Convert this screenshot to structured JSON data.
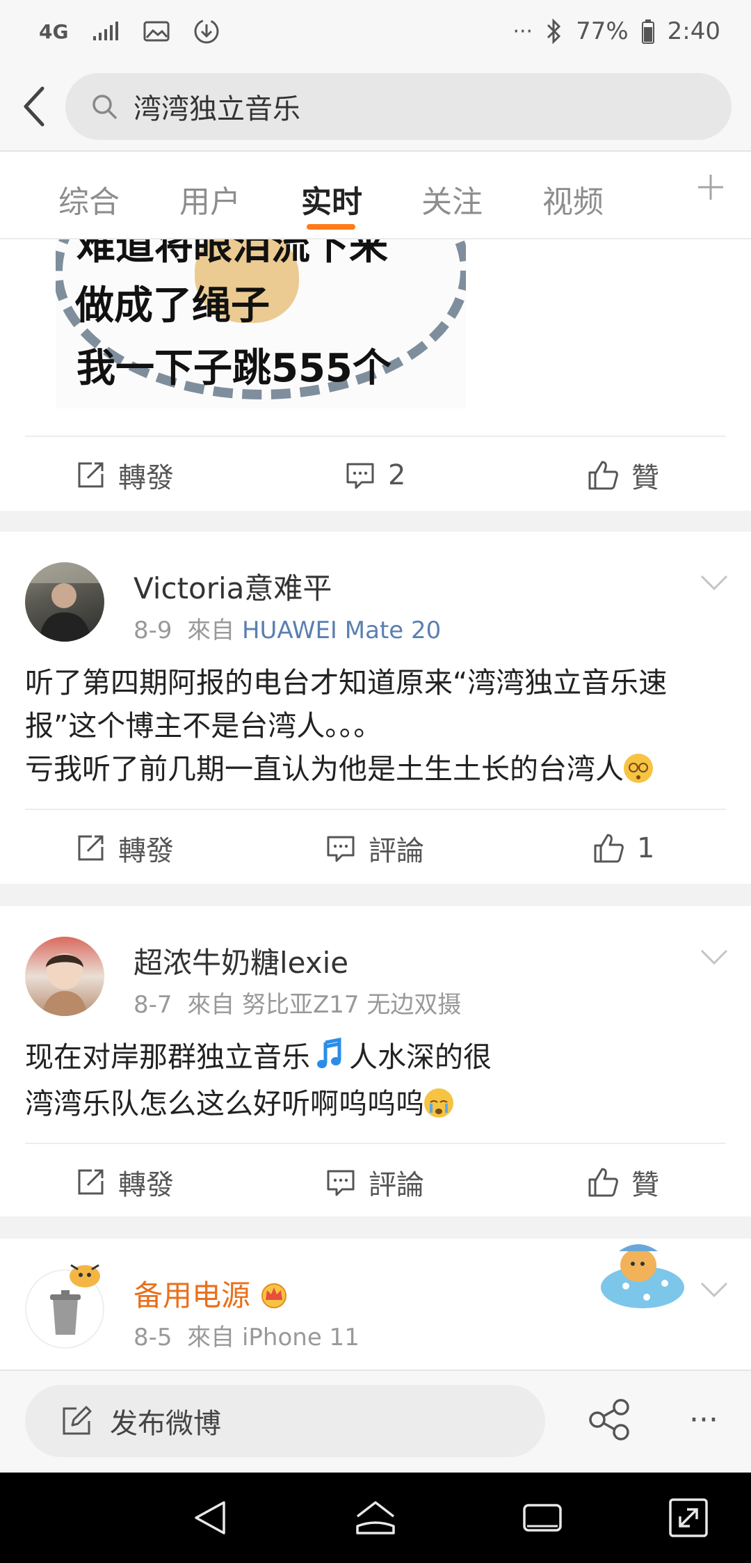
{
  "status_bar": {
    "network": "4G",
    "more": "···",
    "battery": "77%",
    "time": "2:40"
  },
  "search": {
    "query": "湾湾独立音乐"
  },
  "tabs": [
    {
      "label": "综合"
    },
    {
      "label": "用户"
    },
    {
      "label": "实时"
    },
    {
      "label": "关注"
    },
    {
      "label": "视频"
    }
  ],
  "top_card": {
    "meme_lines": [
      "难道将眼泪流下来",
      "做成了绳子",
      "我一下子跳555个"
    ],
    "actions": {
      "repost": "轉發",
      "comment": "2",
      "like": "贊"
    }
  },
  "posts": [
    {
      "username": "Victoria意难平",
      "date": "8-9",
      "from": "來自",
      "source": "HUAWEI Mate 20",
      "lines": [
        "听了第四期阿报的电台才知道原来“湾湾独立音乐速",
        "报”这个博主不是台湾人。。。",
        "亏我听了前几期一直认为他是土生土长的台湾人"
      ],
      "actions": {
        "repost": "轉發",
        "comment": "評論",
        "like": "1"
      }
    },
    {
      "username": "超浓牛奶糖lexie",
      "date": "8-7",
      "from": "來自",
      "source": "努比亚Z17 无边双摄",
      "lines": [
        "现在对岸那群独立音乐",
        "人水深的很",
        "湾湾乐队怎么这么好听啊呜呜呜"
      ],
      "actions": {
        "repost": "轉發",
        "comment": "評論",
        "like": "贊"
      }
    },
    {
      "username": "备用电源",
      "date": "8-5",
      "from": "來自",
      "source": "iPhone 11"
    }
  ],
  "composer": {
    "label": "发布微博",
    "more": "···"
  },
  "colors": {
    "accent": "#ff7a1a",
    "source_link": "#5b7fb0",
    "vip_name": "#e8701c"
  }
}
